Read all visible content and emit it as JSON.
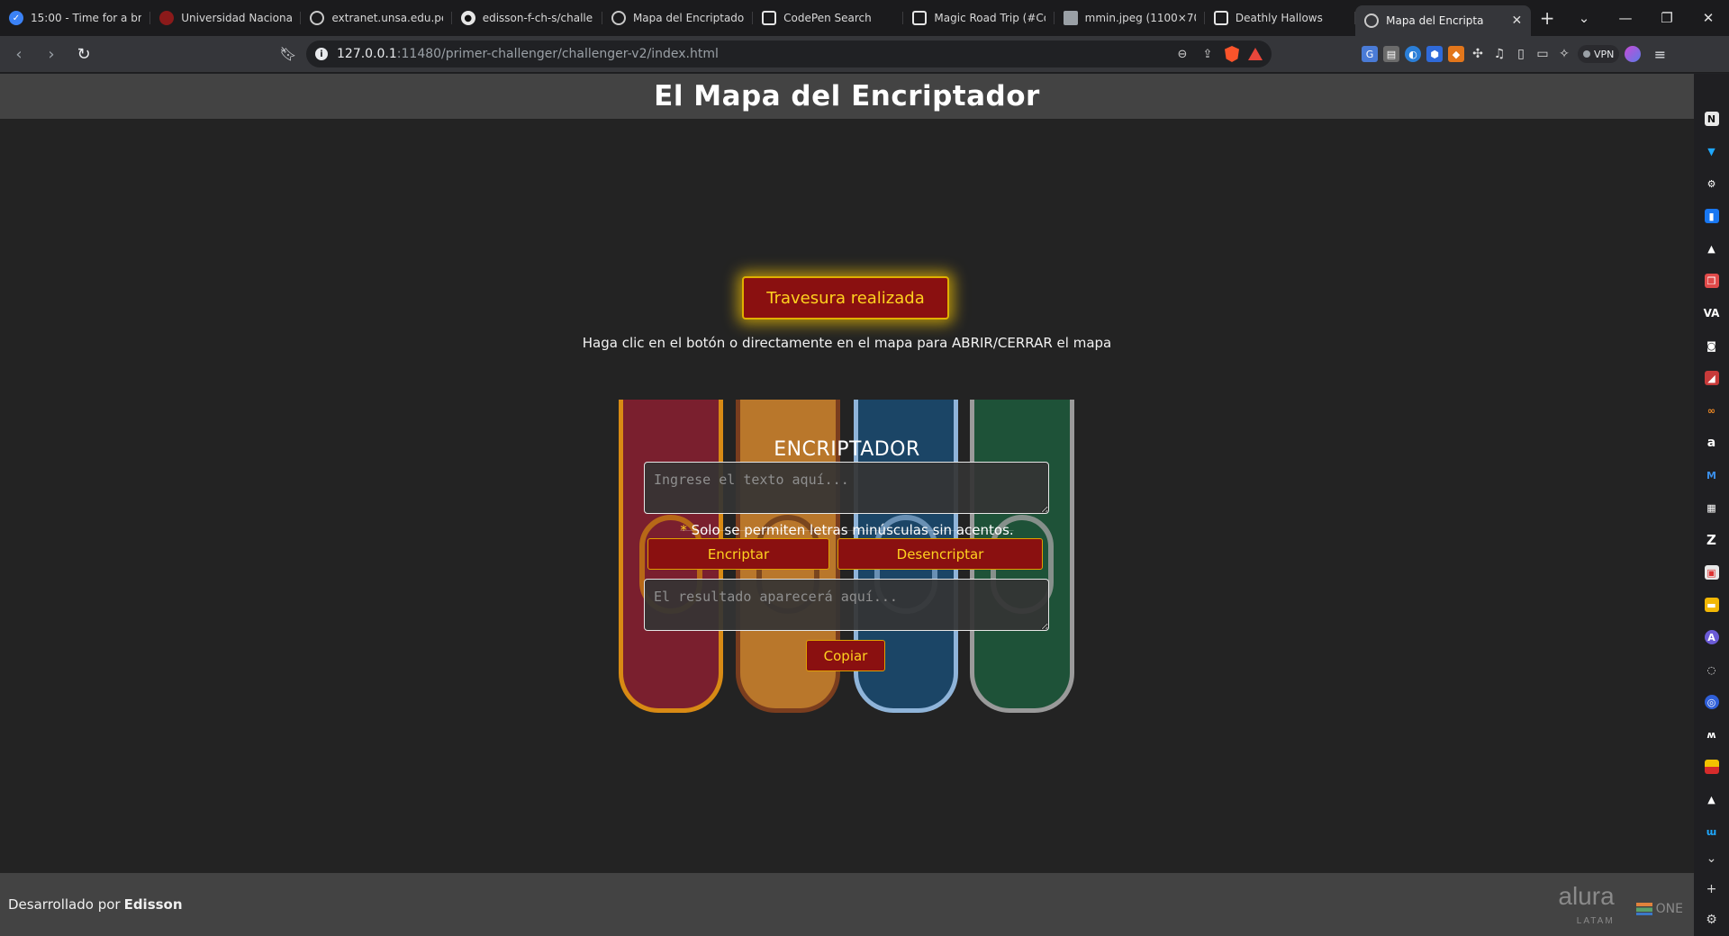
{
  "browser": {
    "tabs": [
      {
        "title": "15:00 - Time for a brea",
        "favicon": "check-circle-icon",
        "color": "#3b82f6"
      },
      {
        "title": "Universidad Nacional d",
        "favicon": "university-icon",
        "color": "#8b1a1a"
      },
      {
        "title": "extranet.unsa.edu.pe",
        "favicon": "globe-icon"
      },
      {
        "title": "edisson-f-ch-s/challen",
        "favicon": "github-icon"
      },
      {
        "title": "Mapa del Encriptador",
        "favicon": "globe-icon"
      },
      {
        "title": "CodePen Search",
        "favicon": "codepen-icon"
      },
      {
        "title": "Magic Road Trip (#Co",
        "favicon": "codepen-icon"
      },
      {
        "title": "mmin.jpeg (1100×709",
        "favicon": "image-icon"
      },
      {
        "title": "Deathly Hallows",
        "favicon": "codepen-icon"
      },
      {
        "title": "Mapa del Encripta",
        "favicon": "globe-icon",
        "active": true
      }
    ],
    "address_bar": {
      "host": "127.0.0.1",
      "path": ":11480/primer-challenger/challenger-v2/index.html"
    },
    "vpn_label": "VPN"
  },
  "page": {
    "title": "El Mapa del Encriptador",
    "toggle_button": "Travesura realizada",
    "instructions": "Haga clic en el botón o directamente en el mapa para ABRIR/CERRAR el mapa",
    "encrypter": {
      "heading": "ENCRIPTADOR",
      "input_placeholder": "Ingrese el texto aquí...",
      "note_star": "*",
      "note": " Solo se permiten letras minúsculas sin acentos.",
      "encrypt_button": "Encriptar",
      "decrypt_button": "Desencriptar",
      "output_placeholder": "El resultado aparecerá aquí...",
      "copy_button": "Copiar"
    },
    "footer": {
      "credit_prefix": "Desarrollado por",
      "author": "Edisson",
      "logo_alura": "alura",
      "logo_alura_sub": "LATAM",
      "logo_one": "ONE"
    }
  },
  "colors": {
    "accent_gold": "#ffd21f",
    "button_red": "#8a1010",
    "banner_gryffindor": "#7a1f2e",
    "banner_hufflepuff": "#b9772b",
    "banner_ravenclaw": "#1b4566",
    "banner_slytherin": "#1e5238"
  }
}
